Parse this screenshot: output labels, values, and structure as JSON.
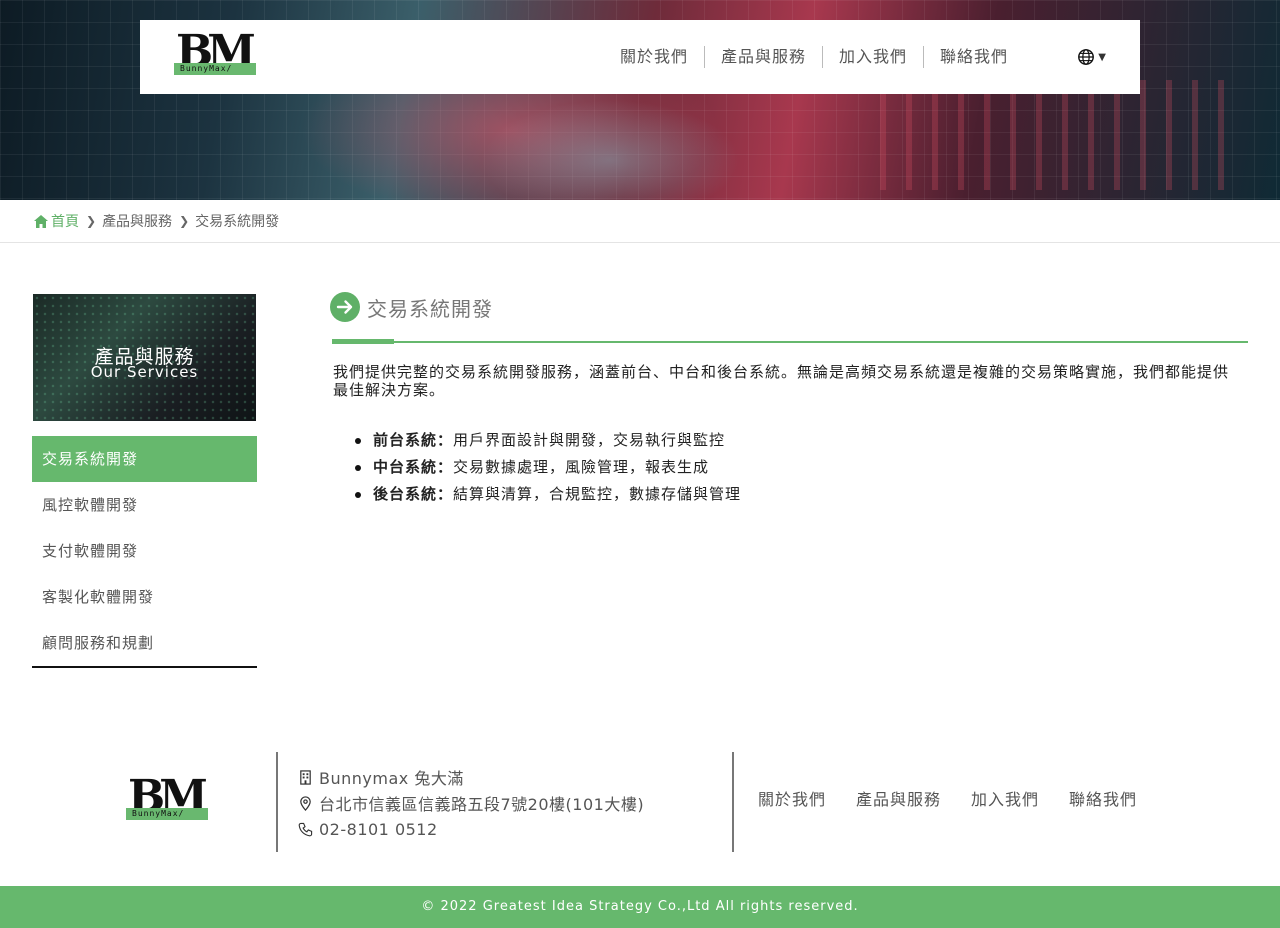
{
  "header": {
    "logo_letters": "BM",
    "logo_strip": "BunnyMax/",
    "nav": [
      "關於我們",
      "產品與服務",
      "加入我們",
      "聯絡我們"
    ],
    "lang_icon": "globe-icon"
  },
  "breadcrumb": {
    "home": "首頁",
    "items": [
      "產品與服務",
      "交易系統開發"
    ]
  },
  "sidebar": {
    "banner_title": "產品與服務",
    "banner_subtitle": "Our Services",
    "items": [
      "交易系統開發",
      "風控軟體開發",
      "支付軟體開發",
      "客製化軟體開發",
      "顧問服務和規劃"
    ],
    "active_index": 0
  },
  "main": {
    "title": "交易系統開發",
    "intro": "我們提供完整的交易系統開發服務，涵蓋前台、中台和後台系統。無論是高頻交易系統還是複雜的交易策略實施，我們都能提供最佳解決方案。",
    "features": [
      {
        "label": "前台系統：",
        "text": "用戶界面設計與開發，交易執行與監控"
      },
      {
        "label": "中台系統：",
        "text": "交易數據處理，風險管理，報表生成"
      },
      {
        "label": "後台系統：",
        "text": "結算與清算，合規監控，數據存儲與管理"
      }
    ]
  },
  "footer": {
    "company": "Bunnymax 兔大滿",
    "address": "台北市信義區信義路五段7號20樓(101大樓)",
    "phone": "02-8101 0512",
    "nav": [
      "關於我們",
      "產品與服務",
      "加入我們",
      "聯絡我們"
    ],
    "copyright": "© 2022 Greatest Idea Strategy Co.,Ltd All rights reserved."
  },
  "colors": {
    "accent": "#66b86d",
    "text": "#333333"
  }
}
